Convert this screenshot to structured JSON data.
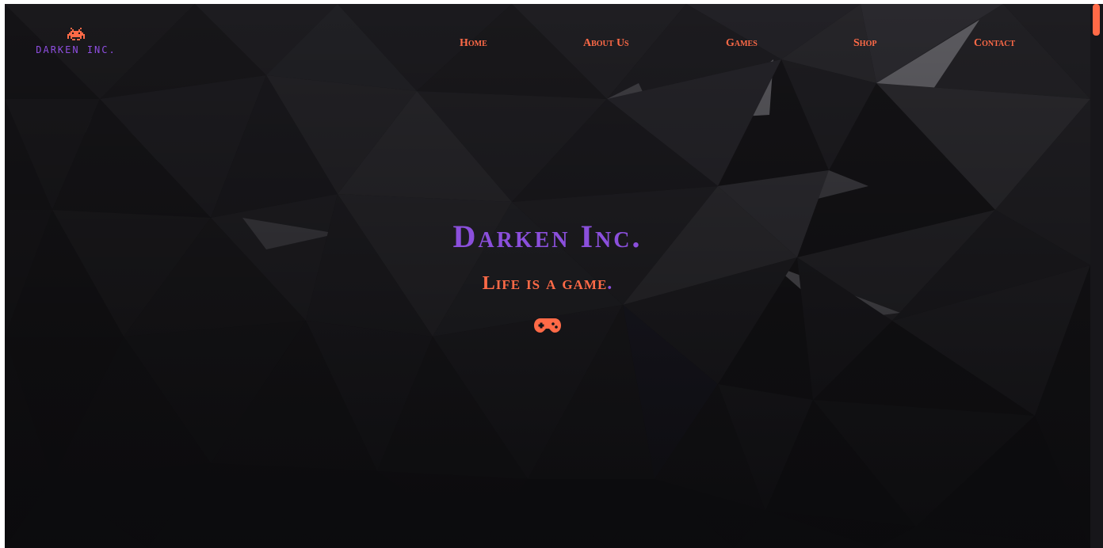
{
  "brand": {
    "logo_icon": "space-invader-icon",
    "name": "DARKEN INC.",
    "accent_color": "#ff6a47",
    "brand_color": "#8b4fdc"
  },
  "nav": {
    "items": [
      {
        "label": "Home"
      },
      {
        "label": "About Us"
      },
      {
        "label": "Games"
      },
      {
        "label": "Shop"
      },
      {
        "label": "Contact"
      }
    ]
  },
  "hero": {
    "title": "Darken Inc",
    "title_dot": ".",
    "subtitle": "Life is a game",
    "subtitle_dot": ".",
    "icon": "gamepad-icon"
  }
}
